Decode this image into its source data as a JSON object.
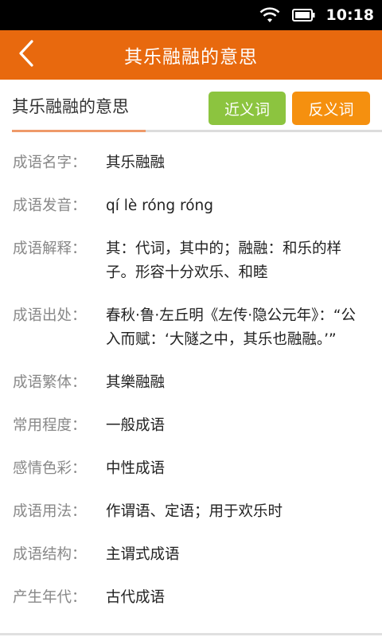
{
  "status": {
    "time": "10:18",
    "icons": [
      "wifi-icon",
      "battery-icon"
    ]
  },
  "appbar": {
    "title": "其乐融融的意思",
    "back_icon": "chevron-left-icon"
  },
  "header": {
    "title": "其乐融融的意思",
    "synonym_label": "近义词",
    "antonym_label": "反义词"
  },
  "colors": {
    "brand": "#e8690e",
    "synonym_button": "#8cc43f",
    "antonym_button": "#f5900f"
  },
  "details": [
    {
      "label": "成语名字：",
      "value": "其乐融融"
    },
    {
      "label": "成语发音：",
      "value": "qí lè róng róng"
    },
    {
      "label": "成语解释：",
      "value": "其：代词，其中的；融融：和乐的样子。形容十分欢乐、和睦"
    },
    {
      "label": "成语出处：",
      "value": "春秋·鲁·左丘明《左传·隐公元年》：“公入而赋：‘大隧之中，其乐也融融。’”"
    },
    {
      "label": "成语繁体：",
      "value": "其樂融融"
    },
    {
      "label": "常用程度：",
      "value": "一般成语"
    },
    {
      "label": "感情色彩：",
      "value": "中性成语"
    },
    {
      "label": "成语用法：",
      "value": "作谓语、定语；用于欢乐时"
    },
    {
      "label": "成语结构：",
      "value": "主谓式成语"
    },
    {
      "label": "产生年代：",
      "value": "古代成语"
    }
  ]
}
